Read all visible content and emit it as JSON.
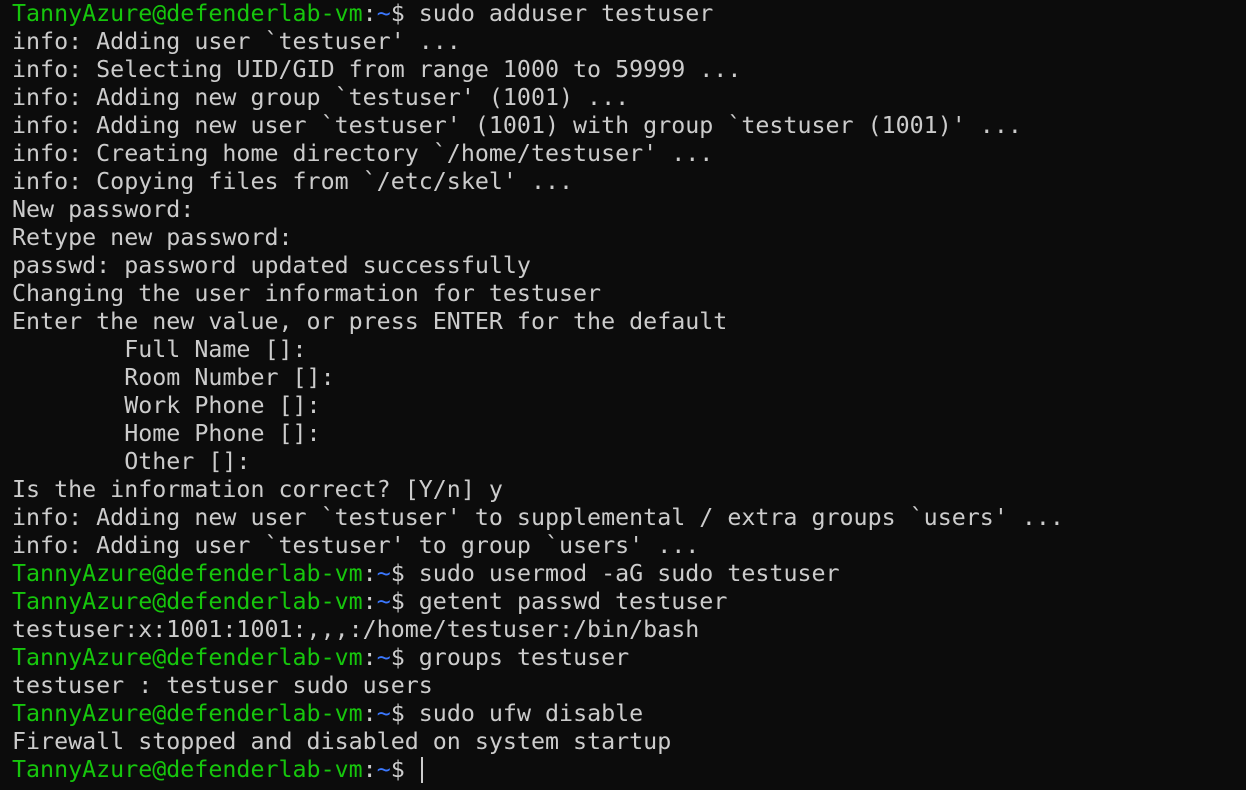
{
  "prompt": {
    "user_host": "TannyAzure@defenderlab-vm",
    "separator": ":",
    "path": "~",
    "symbol": "$ "
  },
  "colors": {
    "background": "#0c0c0c",
    "foreground": "#cccccc",
    "user_host": "#16c60c",
    "path": "#3b78ff"
  },
  "lines": [
    {
      "type": "prompt",
      "command": "sudo adduser testuser"
    },
    {
      "type": "output",
      "text": "info: Adding user `testuser' ..."
    },
    {
      "type": "output",
      "text": "info: Selecting UID/GID from range 1000 to 59999 ..."
    },
    {
      "type": "output",
      "text": "info: Adding new group `testuser' (1001) ..."
    },
    {
      "type": "output",
      "text": "info: Adding new user `testuser' (1001) with group `testuser (1001)' ..."
    },
    {
      "type": "output",
      "text": "info: Creating home directory `/home/testuser' ..."
    },
    {
      "type": "output",
      "text": "info: Copying files from `/etc/skel' ..."
    },
    {
      "type": "output",
      "text": "New password:"
    },
    {
      "type": "output",
      "text": "Retype new password:"
    },
    {
      "type": "output",
      "text": "passwd: password updated successfully"
    },
    {
      "type": "output",
      "text": "Changing the user information for testuser"
    },
    {
      "type": "output",
      "text": "Enter the new value, or press ENTER for the default"
    },
    {
      "type": "output",
      "text": "        Full Name []:"
    },
    {
      "type": "output",
      "text": "        Room Number []:"
    },
    {
      "type": "output",
      "text": "        Work Phone []:"
    },
    {
      "type": "output",
      "text": "        Home Phone []:"
    },
    {
      "type": "output",
      "text": "        Other []:"
    },
    {
      "type": "output",
      "text": "Is the information correct? [Y/n] y"
    },
    {
      "type": "output",
      "text": "info: Adding new user `testuser' to supplemental / extra groups `users' ..."
    },
    {
      "type": "output",
      "text": "info: Adding user `testuser' to group `users' ..."
    },
    {
      "type": "prompt",
      "command": "sudo usermod -aG sudo testuser"
    },
    {
      "type": "prompt",
      "command": "getent passwd testuser"
    },
    {
      "type": "output",
      "text": "testuser:x:1001:1001:,,,:/home/testuser:/bin/bash"
    },
    {
      "type": "prompt",
      "command": "groups testuser"
    },
    {
      "type": "output",
      "text": "testuser : testuser sudo users"
    },
    {
      "type": "prompt",
      "command": "sudo ufw disable"
    },
    {
      "type": "output",
      "text": "Firewall stopped and disabled on system startup"
    },
    {
      "type": "prompt",
      "command": "",
      "active": true
    }
  ]
}
